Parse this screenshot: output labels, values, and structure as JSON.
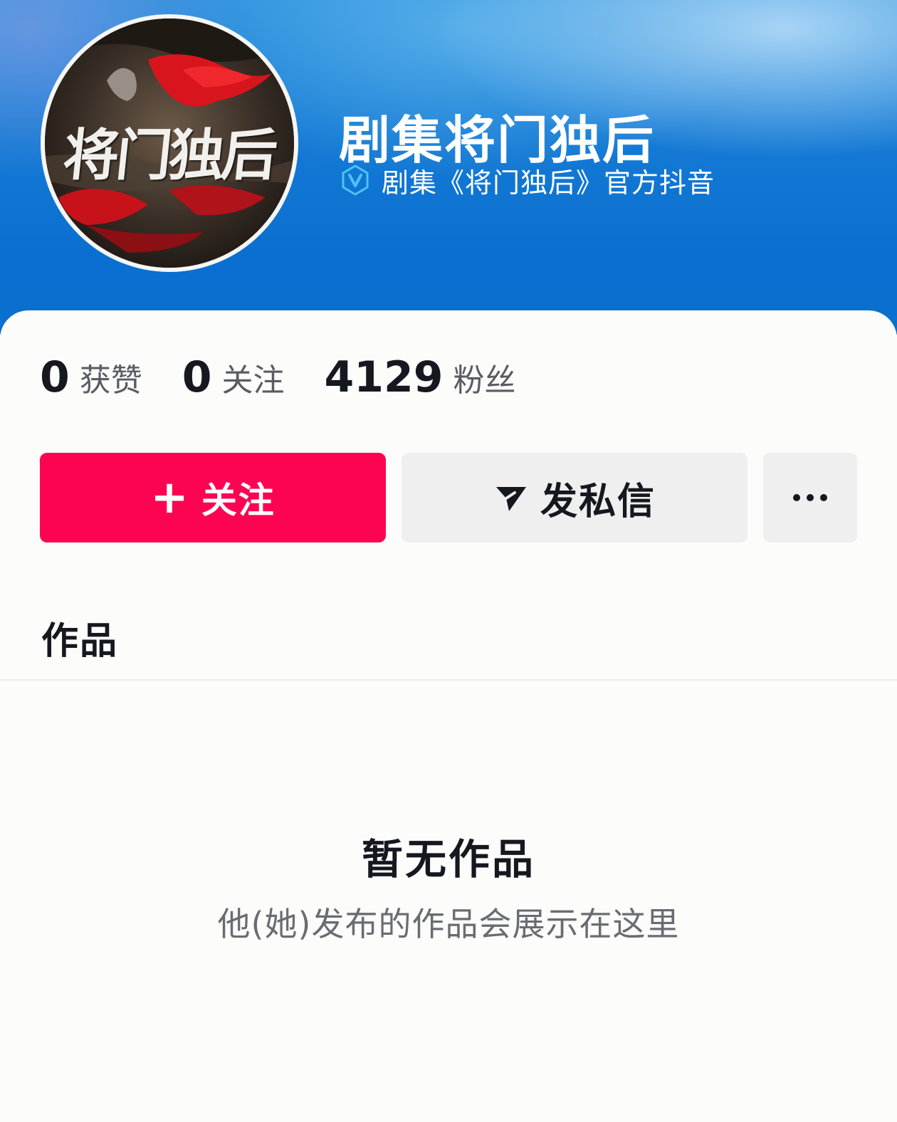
{
  "profile": {
    "avatar_text": "将门独后",
    "username": "剧集将门独后",
    "verified_text": "剧集《将门独后》官方抖音"
  },
  "stats": [
    {
      "value": "0",
      "label": "获赞"
    },
    {
      "value": "0",
      "label": "关注"
    },
    {
      "value": "4129",
      "label": "粉丝"
    }
  ],
  "actions": {
    "follow_plus": "+",
    "follow_label": "关注",
    "message_label": "发私信"
  },
  "tabs": {
    "works_label": "作品"
  },
  "empty_state": {
    "title": "暂无作品",
    "subtitle": "他(她)发布的作品会展示在这里"
  },
  "colors": {
    "follow_button": "#fd0452",
    "banner_blue": "#0b6fce",
    "verify_icon": "#4fc3f7"
  },
  "icons": {
    "verified": "verified-badge-icon",
    "message": "send-icon",
    "more": "more-dots-icon"
  }
}
